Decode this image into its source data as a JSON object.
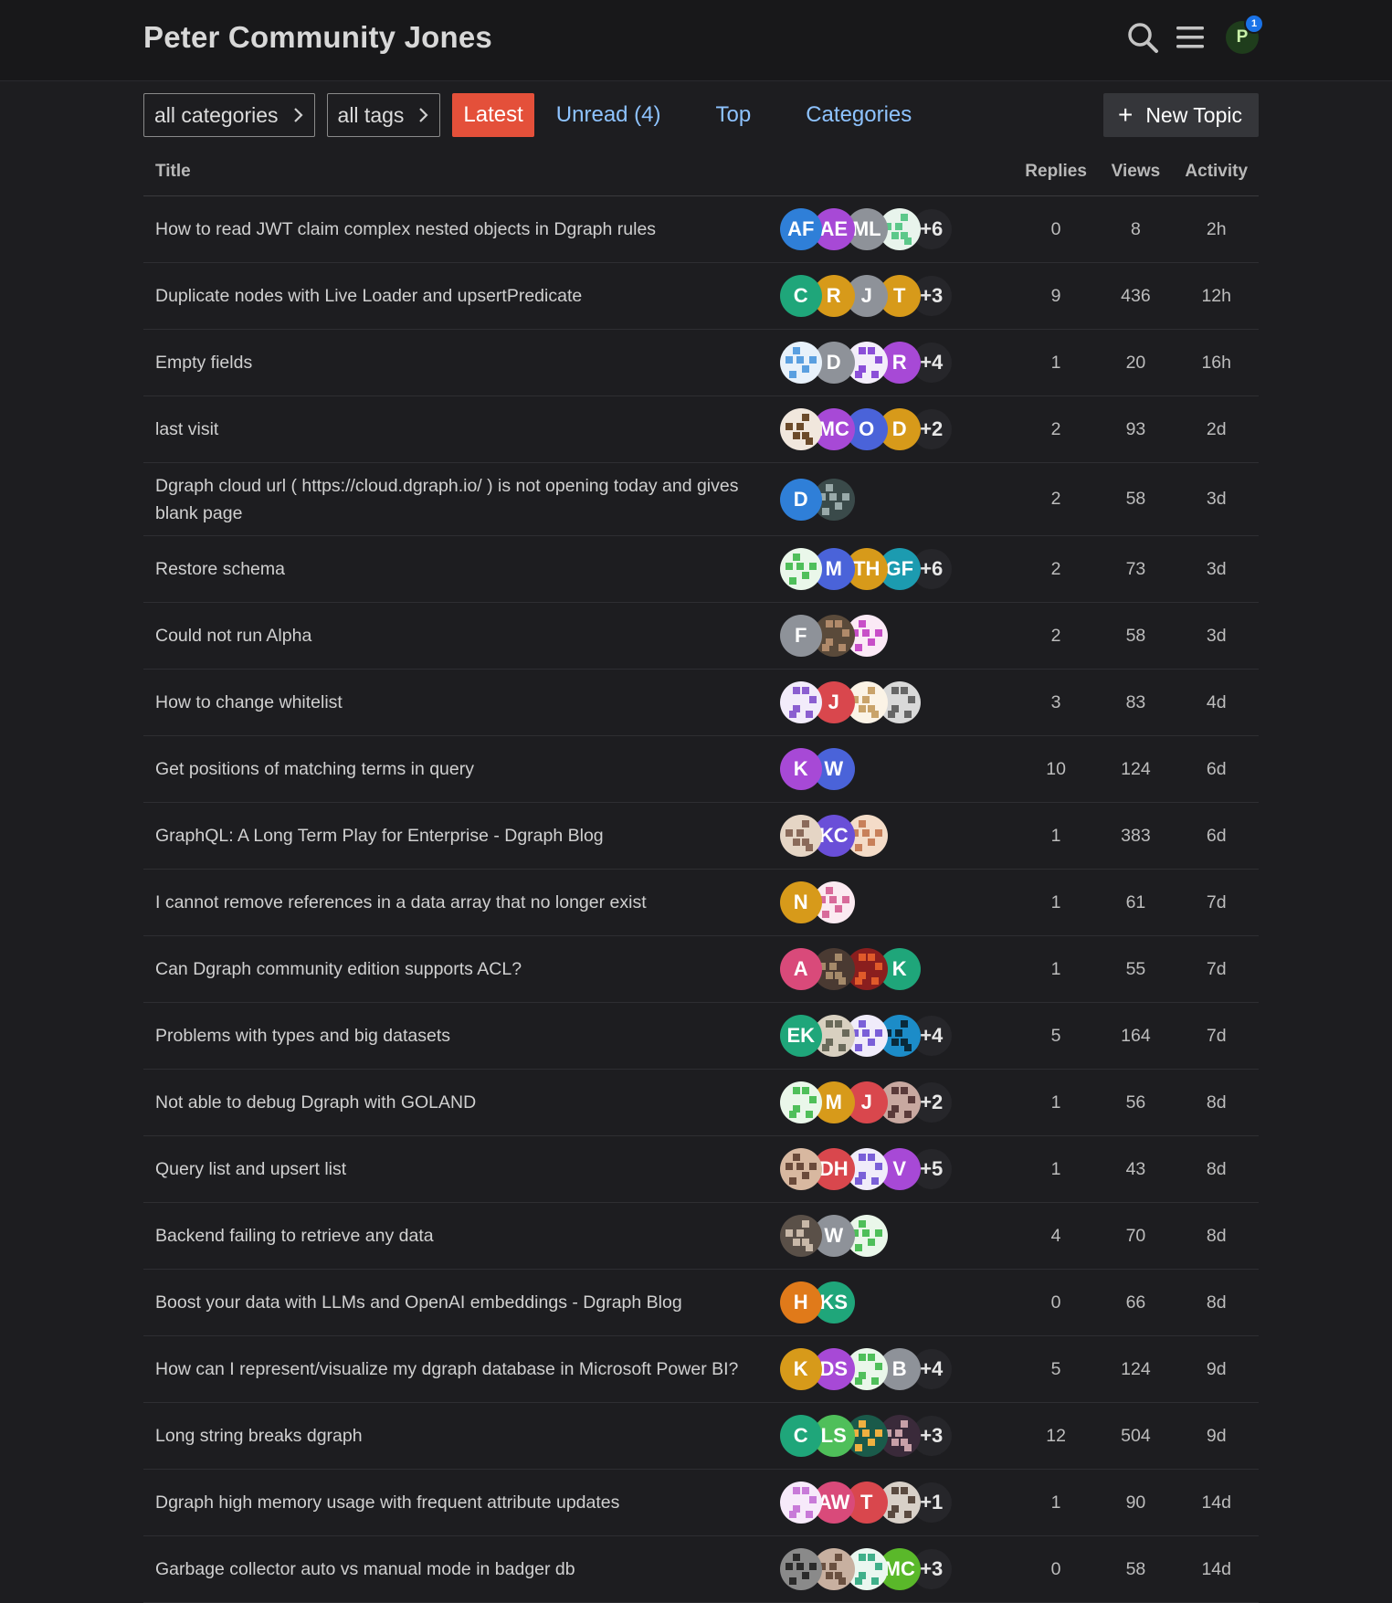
{
  "header": {
    "site_title": "Peter Community Jones",
    "user_initial": "P",
    "notification_count": "1"
  },
  "nav": {
    "categories_dropdown": "all categories",
    "tags_dropdown": "all tags",
    "tabs": [
      {
        "label": "Latest",
        "active": true
      },
      {
        "label": "Unread (4)",
        "active": false
      },
      {
        "label": "Top",
        "active": false
      },
      {
        "label": "Categories",
        "active": false
      }
    ],
    "new_topic_label": "New Topic"
  },
  "table": {
    "headers": {
      "title": "Title",
      "replies": "Replies",
      "views": "Views",
      "activity": "Activity"
    },
    "rows": [
      {
        "title": "How to read JWT claim complex nested objects in Dgraph rules",
        "avatars": [
          {
            "t": "AF",
            "c": "#2f7fd8"
          },
          {
            "t": "AE",
            "c": "#a749d6"
          },
          {
            "t": "ML",
            "c": "#8e9299"
          },
          {
            "t": "",
            "c": "#e8f4ec",
            "p": "#5cc88a"
          }
        ],
        "more": "+6",
        "replies": "0",
        "views": "8",
        "activity": "2h"
      },
      {
        "title": "Duplicate nodes with Live Loader and upsertPredicate",
        "avatars": [
          {
            "t": "C",
            "c": "#1fa67a"
          },
          {
            "t": "R",
            "c": "#d79a1a"
          },
          {
            "t": "J",
            "c": "#8e9299"
          },
          {
            "t": "T",
            "c": "#d79a1a"
          }
        ],
        "more": "+3",
        "replies": "9",
        "views": "436",
        "activity": "12h"
      },
      {
        "title": "Empty fields",
        "avatars": [
          {
            "t": "",
            "c": "#e8f1fa",
            "p": "#5a9fe0"
          },
          {
            "t": "D",
            "c": "#8e9299"
          },
          {
            "t": "",
            "c": "#f3eefa",
            "p": "#8b4fd8"
          },
          {
            "t": "R",
            "c": "#a749d6"
          }
        ],
        "more": "+4",
        "replies": "1",
        "views": "20",
        "activity": "16h"
      },
      {
        "title": "last visit",
        "avatars": [
          {
            "t": "",
            "c": "#f1e7dd",
            "p": "#6b4a2a"
          },
          {
            "t": "MC",
            "c": "#a749d6"
          },
          {
            "t": "O",
            "c": "#4a63d9"
          },
          {
            "t": "D",
            "c": "#d79a1a"
          }
        ],
        "more": "+2",
        "replies": "2",
        "views": "93",
        "activity": "2d"
      },
      {
        "title": "Dgraph cloud url ( https://cloud.dgraph.io/ ) is not opening today and gives blank page",
        "avatars": [
          {
            "t": "D",
            "c": "#2f7fd8"
          },
          {
            "t": "",
            "c": "#3a4a4a",
            "p": "#9aa"
          }
        ],
        "more": "",
        "replies": "2",
        "views": "58",
        "activity": "3d"
      },
      {
        "title": "Restore schema",
        "avatars": [
          {
            "t": "",
            "c": "#eaf7ea",
            "p": "#4fbf5a"
          },
          {
            "t": "M",
            "c": "#4a63d9"
          },
          {
            "t": "TH",
            "c": "#d79a1a"
          },
          {
            "t": "GF",
            "c": "#1c9bb0"
          }
        ],
        "more": "+6",
        "replies": "2",
        "views": "73",
        "activity": "3d"
      },
      {
        "title": "Could not run Alpha",
        "avatars": [
          {
            "t": "F",
            "c": "#8e9299"
          },
          {
            "t": "",
            "c": "#5a4a3a",
            "p": "#b08a6a"
          },
          {
            "t": "",
            "c": "#fbeaf6",
            "p": "#c84fc8"
          }
        ],
        "more": "",
        "replies": "2",
        "views": "58",
        "activity": "3d"
      },
      {
        "title": "How to change whitelist",
        "avatars": [
          {
            "t": "",
            "c": "#f2ecfa",
            "p": "#8b5fd0"
          },
          {
            "t": "J",
            "c": "#d9474d"
          },
          {
            "t": "",
            "c": "#fbf3e6",
            "p": "#c9a36a"
          },
          {
            "t": "",
            "c": "#d9d9d9",
            "p": "#666"
          }
        ],
        "more": "",
        "replies": "3",
        "views": "83",
        "activity": "4d"
      },
      {
        "title": "Get positions of matching terms in query",
        "avatars": [
          {
            "t": "K",
            "c": "#a749d6"
          },
          {
            "t": "W",
            "c": "#4a63d9"
          }
        ],
        "more": "",
        "replies": "10",
        "views": "124",
        "activity": "6d"
      },
      {
        "title": "GraphQL: A Long Term Play for Enterprise - Dgraph Blog",
        "avatars": [
          {
            "t": "",
            "c": "#e5d5c5",
            "p": "#8a6a5a"
          },
          {
            "t": "KC",
            "c": "#6a4fd8"
          },
          {
            "t": "",
            "c": "#f4dcc8",
            "p": "#c8805a"
          }
        ],
        "more": "",
        "replies": "1",
        "views": "383",
        "activity": "6d"
      },
      {
        "title": "I cannot remove references in a data array that no longer exist",
        "avatars": [
          {
            "t": "N",
            "c": "#d79a1a"
          },
          {
            "t": "",
            "c": "#fbeaf1",
            "p": "#d86a9a"
          }
        ],
        "more": "",
        "replies": "1",
        "views": "61",
        "activity": "7d"
      },
      {
        "title": "Can Dgraph community edition supports ACL?",
        "avatars": [
          {
            "t": "A",
            "c": "#d94a7a"
          },
          {
            "t": "",
            "c": "#4a3a32",
            "p": "#a58a6a"
          },
          {
            "t": "",
            "c": "#8a1e1e",
            "p": "#e05a2a"
          },
          {
            "t": "K",
            "c": "#1fa67a"
          }
        ],
        "more": "",
        "replies": "1",
        "views": "55",
        "activity": "7d"
      },
      {
        "title": "Problems with types and big datasets",
        "avatars": [
          {
            "t": "EK",
            "c": "#1fa67a"
          },
          {
            "t": "",
            "c": "#d8d0c0",
            "p": "#6a6a5a"
          },
          {
            "t": "",
            "c": "#f0ecfa",
            "p": "#7a5fd8"
          },
          {
            "t": "",
            "c": "#1c8cc8",
            "p": "#0a2a3a"
          }
        ],
        "more": "+4",
        "replies": "5",
        "views": "164",
        "activity": "7d"
      },
      {
        "title": "Not able to debug Dgraph with GOLAND",
        "avatars": [
          {
            "t": "",
            "c": "#eaf7ea",
            "p": "#4fbf5a"
          },
          {
            "t": "M",
            "c": "#d79a1a"
          },
          {
            "t": "J",
            "c": "#d9474d"
          },
          {
            "t": "",
            "c": "#c8a8a0",
            "p": "#5a3a3a"
          }
        ],
        "more": "+2",
        "replies": "1",
        "views": "56",
        "activity": "8d"
      },
      {
        "title": "Query list and upsert list",
        "avatars": [
          {
            "t": "",
            "c": "#d8b8a0",
            "p": "#6a4a3a"
          },
          {
            "t": "DH",
            "c": "#d9474d"
          },
          {
            "t": "",
            "c": "#f0ecfa",
            "p": "#7a5fd8"
          },
          {
            "t": "V",
            "c": "#a749d6"
          }
        ],
        "more": "+5",
        "replies": "1",
        "views": "43",
        "activity": "8d"
      },
      {
        "title": "Backend failing to retrieve any data",
        "avatars": [
          {
            "t": "",
            "c": "#5a5048",
            "p": "#c8b8a8"
          },
          {
            "t": "W",
            "c": "#8e9299"
          },
          {
            "t": "",
            "c": "#eaf7ea",
            "p": "#4fbf5a"
          }
        ],
        "more": "",
        "replies": "4",
        "views": "70",
        "activity": "8d"
      },
      {
        "title": "Boost your data with LLMs and OpenAI embeddings - Dgraph Blog",
        "avatars": [
          {
            "t": "H",
            "c": "#e07a1a"
          },
          {
            "t": "KS",
            "c": "#1fa67a"
          }
        ],
        "more": "",
        "replies": "0",
        "views": "66",
        "activity": "8d"
      },
      {
        "title": "How can I represent/visualize my dgraph database in Microsoft Power BI?",
        "avatars": [
          {
            "t": "K",
            "c": "#d79a1a"
          },
          {
            "t": "DS",
            "c": "#a749d6"
          },
          {
            "t": "",
            "c": "#eaf7ea",
            "p": "#4fbf5a"
          },
          {
            "t": "B",
            "c": "#8e9299"
          }
        ],
        "more": "+4",
        "replies": "5",
        "views": "124",
        "activity": "9d"
      },
      {
        "title": "Long string breaks dgraph",
        "avatars": [
          {
            "t": "C",
            "c": "#1fa67a"
          },
          {
            "t": "LS",
            "c": "#4fbf5a"
          },
          {
            "t": "",
            "c": "#1a5a4a",
            "p": "#f0b040"
          },
          {
            "t": "",
            "c": "#3a2a3a",
            "p": "#c8a0a8"
          }
        ],
        "more": "+3",
        "replies": "12",
        "views": "504",
        "activity": "9d"
      },
      {
        "title": "Dgraph high memory usage with frequent attribute updates",
        "avatars": [
          {
            "t": "",
            "c": "#f7eafa",
            "p": "#c87ad8"
          },
          {
            "t": "AW",
            "c": "#d94a7a"
          },
          {
            "t": "T",
            "c": "#d9474d"
          },
          {
            "t": "",
            "c": "#d8d0c8",
            "p": "#5a4a40"
          }
        ],
        "more": "+1",
        "replies": "1",
        "views": "90",
        "activity": "14d"
      },
      {
        "title": "Garbage collector auto vs manual mode in badger db",
        "avatars": [
          {
            "t": "",
            "c": "#8a8a8a",
            "p": "#2a2a2a"
          },
          {
            "t": "",
            "c": "#c8b0a0",
            "p": "#6a5040"
          },
          {
            "t": "",
            "c": "#eaf7f0",
            "p": "#3fb08a"
          },
          {
            "t": "MC",
            "c": "#5ab82a"
          }
        ],
        "more": "+3",
        "replies": "0",
        "views": "58",
        "activity": "14d"
      }
    ]
  }
}
